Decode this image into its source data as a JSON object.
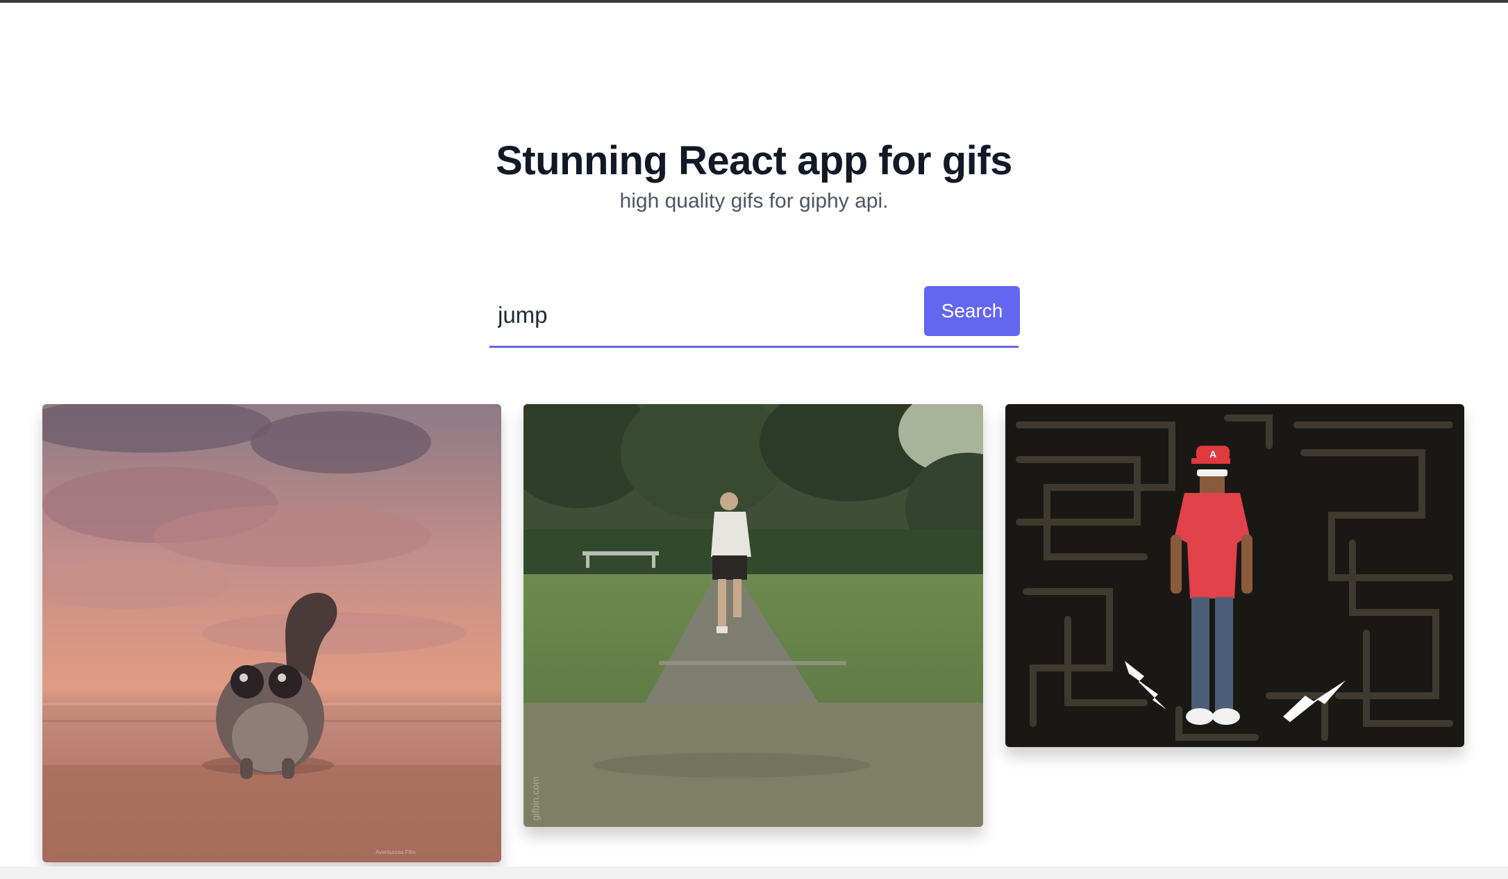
{
  "header": {
    "title": "Stunning React app for gifs",
    "subtitle": "high quality gifs for giphy api."
  },
  "search": {
    "value": "jump",
    "button_label": "Search"
  },
  "gifs": [
    {
      "subject": "animated lemur walking on beach at sunset",
      "watermark": "Aventurosa Film"
    },
    {
      "subject": "person running on grass track toward camera",
      "watermark": "gifbin.com"
    },
    {
      "subject": "dancer in red cap and red t-shirt with lightning bolts on black maze background",
      "cap_letter": "A"
    }
  ],
  "colors": {
    "accent": "#6366f1",
    "title": "#111827",
    "subtitle": "#4b5563"
  }
}
